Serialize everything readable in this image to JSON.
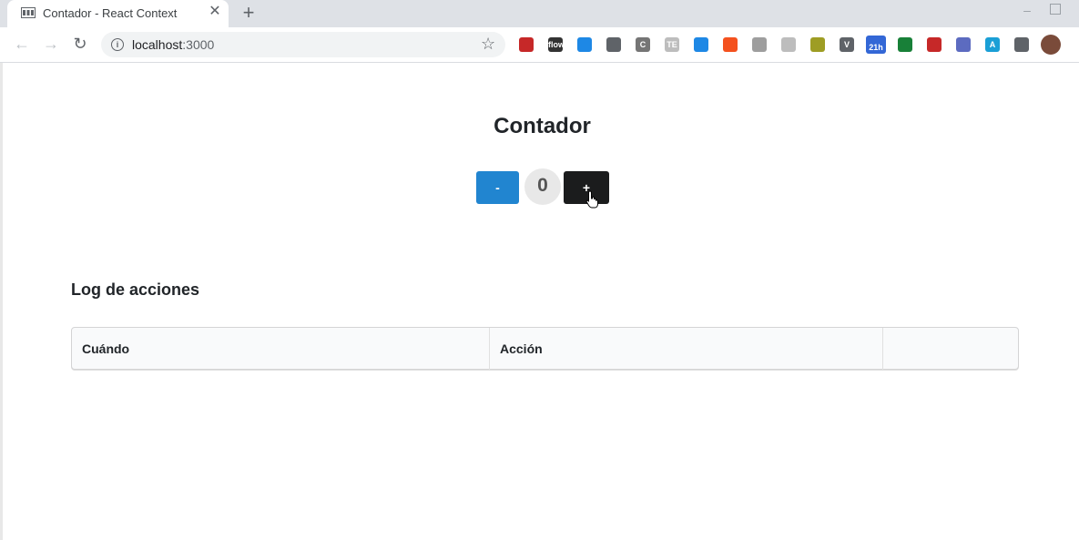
{
  "browser": {
    "tab_title": "Contador - React Context",
    "tab_close": "✕",
    "new_tab": "+",
    "url_host": "localhost",
    "url_port": ":3000",
    "extensions": [
      {
        "name": "ext-red-icon",
        "color": "#c62828",
        "label": ""
      },
      {
        "name": "flow-icon",
        "color": "#333333",
        "label": "flow"
      },
      {
        "name": "cube-icon",
        "color": "#1e88e5",
        "label": ""
      },
      {
        "name": "grid-icon",
        "color": "#5f6368",
        "label": ""
      },
      {
        "name": "c-icon",
        "color": "#757575",
        "label": "C"
      },
      {
        "name": "te-icon",
        "color": "#bdbdbd",
        "label": "TE"
      },
      {
        "name": "trello-icon",
        "color": "#1e88e5",
        "label": ""
      },
      {
        "name": "orange-circle-icon",
        "color": "#f4511e",
        "label": ""
      },
      {
        "name": "dot-icon",
        "color": "#9e9e9e",
        "label": ""
      },
      {
        "name": "ring-icon",
        "color": "#bdbdbd",
        "label": ""
      },
      {
        "name": "list-icon",
        "color": "#9e9d24",
        "label": ""
      },
      {
        "name": "vue-icon",
        "color": "#5f6368",
        "label": "V"
      },
      {
        "name": "calendar-icon",
        "color": "#3367d6",
        "label": "21h"
      },
      {
        "name": "sheets-icon",
        "color": "#188038",
        "label": ""
      },
      {
        "name": "play-icon",
        "color": "#c62828",
        "label": ""
      },
      {
        "name": "sun-icon",
        "color": "#5c6bc0",
        "label": ""
      },
      {
        "name": "a-icon",
        "color": "#1a9fd6",
        "label": "A"
      },
      {
        "name": "puzzle-icon",
        "color": "#5f6368",
        "label": ""
      }
    ]
  },
  "page": {
    "title": "Contador",
    "decrement_label": "-",
    "count": "0",
    "increment_label": "+",
    "log_title": "Log de acciones",
    "table_headers": [
      "Cuándo",
      "Acción",
      ""
    ]
  }
}
